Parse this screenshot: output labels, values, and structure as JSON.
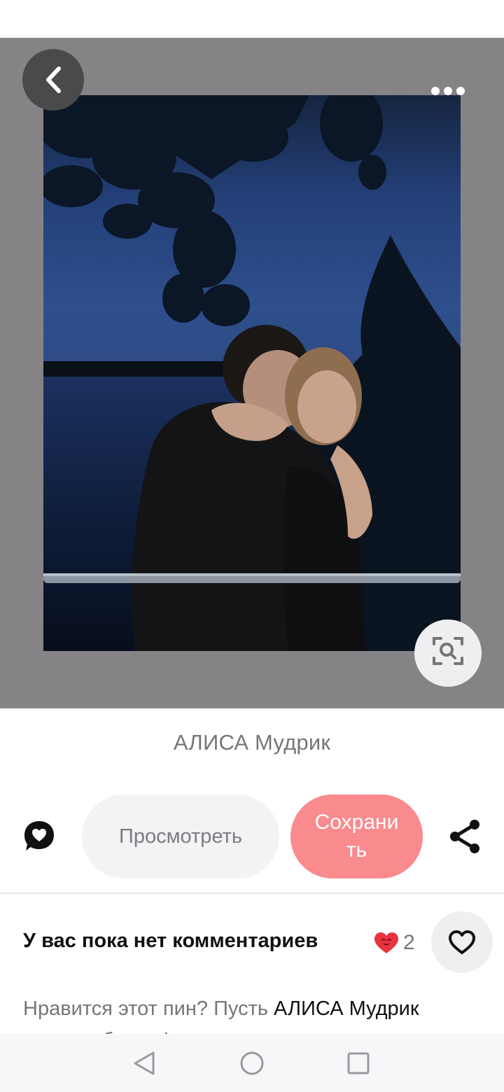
{
  "pin": {
    "author": "АЛИСА Мудрик"
  },
  "actions": {
    "view_label": "Просмотреть",
    "save_label": "Сохранить",
    "save_color": "#f98a8e"
  },
  "comments": {
    "heading": "У вас пока нет комментариев",
    "reaction_count": "2",
    "prompt_prefix": "Нравится этот пин? Пусть ",
    "prompt_author": "АЛИСА Мудрик",
    "prompt_suffix": "узнает об этом!"
  },
  "icons": {
    "back": "chevron-left-icon",
    "more": "more-dots-icon",
    "visual_search": "visual-search-icon",
    "comment": "comment-heart-icon",
    "share": "share-icon",
    "like": "heart-outline-icon",
    "reaction": "heart-face-emoji-icon"
  }
}
